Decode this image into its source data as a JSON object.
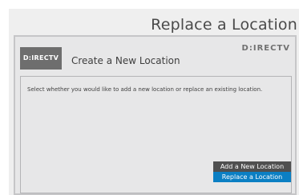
{
  "header": {
    "title": "Replace a Location"
  },
  "dialog": {
    "logo_text": "D:IRECTV",
    "title": "Create a New Location",
    "brand_text": "D:IRECTV",
    "instructions": "Select whether you would like to add a new location or replace an existing location."
  },
  "options": [
    {
      "label": "Add a New Location",
      "selected": false
    },
    {
      "label": "Replace a Location",
      "selected": true
    }
  ],
  "colors": {
    "selected_option": "#0b7fc3",
    "unselected_option": "#4f4f4f",
    "logo_tile": "#6e6e6e"
  }
}
